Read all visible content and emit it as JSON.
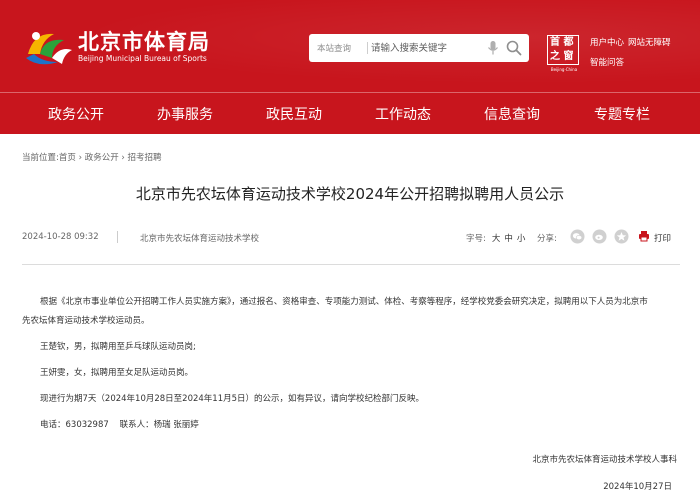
{
  "header": {
    "site_name": "北京市体育局",
    "site_name_en": "Beijing Municipal Bureau of Sports",
    "search_scope": "本站查询",
    "search_placeholder": "请输入搜索关键字",
    "capital_logo_text_1": "首 都",
    "capital_logo_text_2": "之 窗",
    "capital_logo_sub": "Beijing·China",
    "links": [
      "用户中心",
      "网站无障碍",
      "智能问答"
    ]
  },
  "nav": {
    "items": [
      "政务公开",
      "办事服务",
      "政民互动",
      "工作动态",
      "信息查询",
      "专题专栏"
    ]
  },
  "breadcrumb": {
    "label": "当前位置:",
    "items": [
      "首页",
      "政务公开",
      "招考招聘"
    ],
    "separator": "›"
  },
  "article": {
    "title": "北京市先农坛体育运动技术学校2024年公开招聘拟聘用人员公示",
    "date": "2024-10-28 09:32",
    "source": "北京市先农坛体育运动技术学校",
    "font_label": "字号:",
    "font_sizes": [
      "大",
      "中",
      "小"
    ],
    "share_label": "分享:",
    "share_icons": [
      "wechat-icon",
      "weibo-icon",
      "qzone-icon"
    ],
    "print_label": "打印",
    "paragraphs": [
      "根据《北京市事业单位公开招聘工作人员实施方案》，通过报名、资格审查、专项能力测试、体检、考察等程序，经学校党委会研究决定，拟聘用以下人员为北京市",
      "先农坛体育运动技术学校运动员。",
      "王楚钦，男，拟聘用至乒乓球队运动员岗;",
      "王妍雯，女，拟聘用至女足队运动员岗。",
      "现进行为期7天（2024年10月28日至2024年11月5日）的公示，如有异议，请向学校纪检部门反映。",
      "电话：63032987    联系人：杨瑞 张丽婷"
    ],
    "signature": "北京市先农坛体育运动技术学校人事科",
    "sign_date": "2024年10月27日"
  },
  "colors": {
    "brand_red": "#c8151d"
  }
}
